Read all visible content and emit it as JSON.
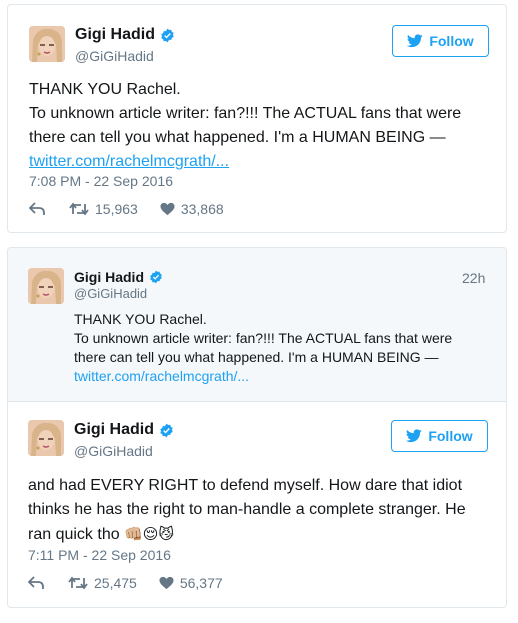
{
  "tweet1": {
    "display_name": "Gigi Hadid",
    "handle": "@GiGiHadid",
    "follow_label": "Follow",
    "lines": [
      "THANK YOU Rachel.",
      "To unknown article writer: fan?!!! The ACTUAL fans that were",
      "there can tell you what happened. I'm a HUMAN BEING —"
    ],
    "link": "twitter.com/rachelmcgrath/...",
    "timestamp": "7:08 PM - 22 Sep 2016",
    "retweets": "15,963",
    "likes": "33,868"
  },
  "quoted": {
    "display_name": "Gigi Hadid",
    "handle": "@GiGiHadid",
    "age": "22h",
    "lines": [
      "THANK YOU Rachel.",
      "To unknown article writer: fan?!!! The ACTUAL fans that were",
      "there can tell you what happened. I'm a HUMAN BEING —"
    ],
    "link": "twitter.com/rachelmcgrath/..."
  },
  "tweet2": {
    "display_name": "Gigi Hadid",
    "handle": "@GiGiHadid",
    "follow_label": "Follow",
    "lines": [
      "and had EVERY RIGHT to defend myself. How dare that idiot",
      "thinks he has the right to man-handle a complete stranger. He",
      "ran quick tho"
    ],
    "emojis": [
      "👊🏼",
      "😌",
      "😼"
    ],
    "timestamp": "7:11 PM - 22 Sep 2016",
    "retweets": "25,475",
    "likes": "56,377"
  },
  "colors": {
    "accent": "#1da1f2",
    "muted": "#657786",
    "border": "#e1e8ed",
    "quote_bg": "#f5f8fa"
  },
  "icons": {
    "verified": "verified-badge-icon",
    "bird": "twitter-bird-icon",
    "reply": "reply-icon",
    "retweet": "retweet-icon",
    "like": "heart-icon"
  }
}
